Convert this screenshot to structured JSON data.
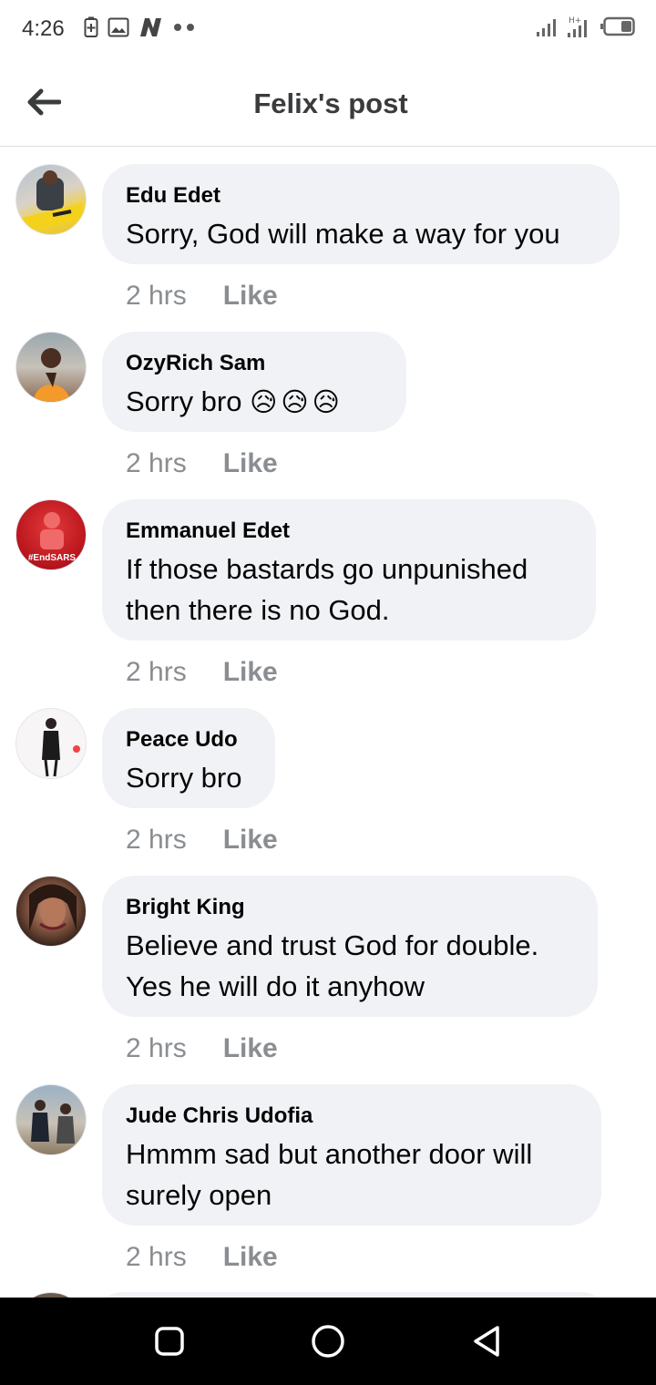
{
  "status_bar": {
    "time": "4:26",
    "left_icons": [
      "battery-saver-icon",
      "image-icon",
      "n-app-icon",
      "more-dots-icon"
    ],
    "right_icons": [
      "signal-icon",
      "signal-ht-icon",
      "battery-icon"
    ]
  },
  "header": {
    "title": "Felix's post",
    "back_icon": "back-arrow-icon"
  },
  "comments": [
    {
      "author": "Edu Edet",
      "text": "Sorry, God will make a way for you",
      "time": "2 hrs",
      "like": "Like"
    },
    {
      "author": "OzyRich Sam",
      "text": "Sorry bro",
      "emoji": "😥😥😥",
      "time": "2 hrs",
      "like": "Like"
    },
    {
      "author": "Emmanuel Edet",
      "text_lines": [
        "If those bastards go unpunished",
        "then there is no God."
      ],
      "time": "2 hrs",
      "like": "Like",
      "avatar_caption": "#EndSARS"
    },
    {
      "author": "Peace Udo",
      "text": "Sorry bro",
      "time": "2 hrs",
      "like": "Like"
    },
    {
      "author": "Bright King",
      "text_lines": [
        "Believe and trust God for double.",
        "Yes he will do it anyhow"
      ],
      "time": "2 hrs",
      "like": "Like"
    },
    {
      "author": "Jude Chris Udofia",
      "text_lines": [
        "Hmmm sad but another door will",
        "surely open"
      ],
      "time": "2 hrs",
      "like": "Like"
    }
  ],
  "nav_bar": {
    "buttons": [
      "recent-apps-icon",
      "home-icon",
      "back-icon"
    ]
  },
  "colors": {
    "bubble": "#f0f2f5",
    "meta_text": "#8a8d91",
    "title_text": "#3a3b3c",
    "nav_bg": "#000000"
  }
}
